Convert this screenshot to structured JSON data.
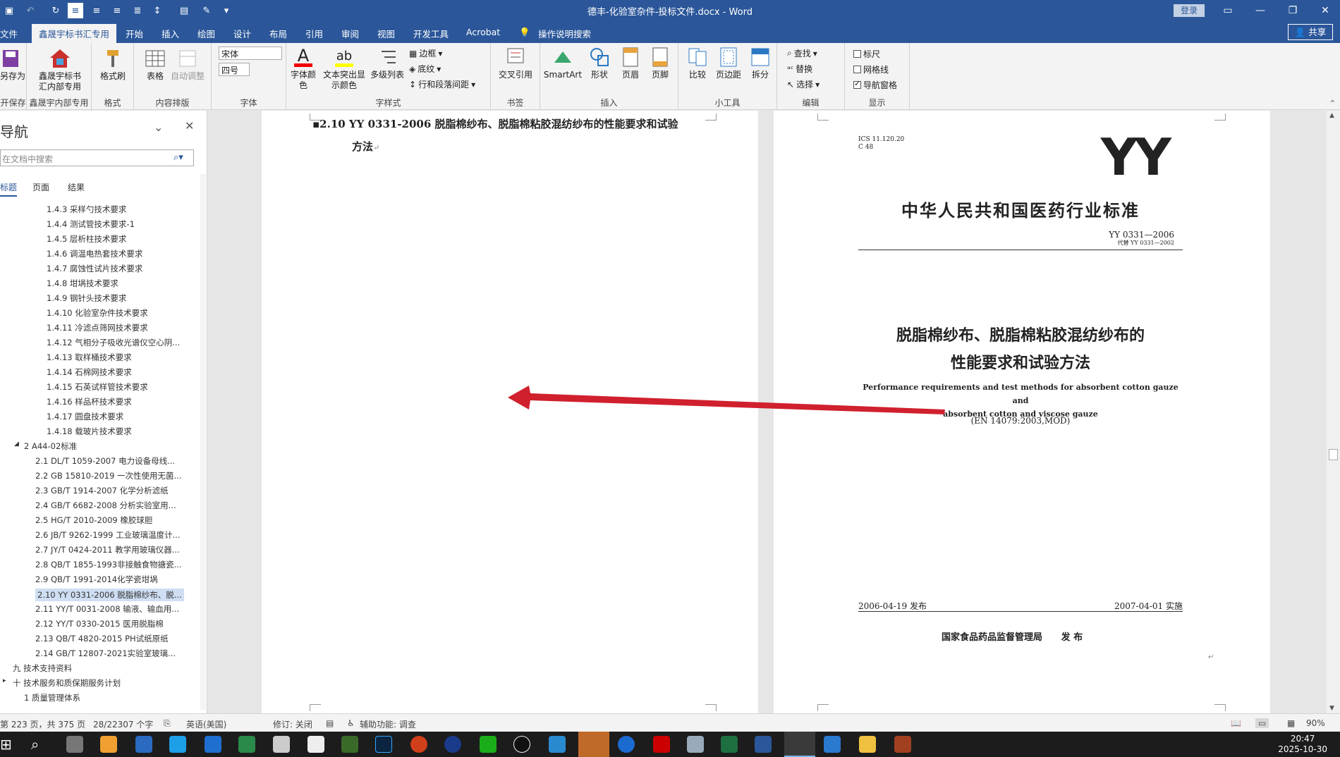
{
  "titlebar": {
    "title": "德丰-化验室杂件-投标文件.docx  -  Word",
    "login": "登录"
  },
  "tabs": [
    "文件",
    "鑫晟宇标书汇专用",
    "开始",
    "插入",
    "绘图",
    "设计",
    "布局",
    "引用",
    "审阅",
    "视图",
    "开发工具",
    "Acrobat",
    "操作说明搜索"
  ],
  "share": "共享",
  "ribbon": {
    "save_as": "另存为",
    "group_save": "开保存",
    "xsy_button": "鑫晟宇标书汇内部专用",
    "group_xsy": "鑫晟宇内部专用",
    "format_painter": "格式刷",
    "group_format": "格式",
    "table": "表格",
    "auto_adjust": "自动调整",
    "group_content": "内容排版",
    "font_name": "宋体",
    "font_size": "四号",
    "group_font": "字体",
    "font_color": "字体颜色",
    "highlight": "文本突出显示颜色",
    "multilevel": "多级列表",
    "border": "边框",
    "shading": "底纹",
    "line_spacing": "行和段落间距",
    "group_style": "字样式",
    "cross_ref": "交叉引用",
    "group_bookmark": "书签",
    "smartart": "SmartArt",
    "shapes": "形状",
    "header": "页眉",
    "footer": "页脚",
    "group_insert": "插入",
    "compare": "比较",
    "margins": "页边距",
    "split": "拆分",
    "group_tools": "小工具",
    "find": "查找",
    "replace": "替换",
    "select": "选择",
    "group_edit": "编辑",
    "ruler": "标尺",
    "gridlines": "网格线",
    "nav_pane": "导航窗格",
    "group_show": "显示"
  },
  "nav": {
    "title": "导航",
    "search_placeholder": "在文档中搜索",
    "tabs": [
      "标题",
      "页面",
      "结果"
    ],
    "items": [
      "1.4.3 采样勺技术要求",
      "1.4.4 测试管技术要求-1",
      "1.4.5 层析柱技术要求",
      "1.4.6 调温电热套技术要求",
      "1.4.7 腐蚀性试片技术要求",
      "1.4.8 坩埚技术要求",
      "1.4.9 钢针头技术要求",
      "1.4.10 化验室杂件技术要求",
      "1.4.11 冷滤点筛网技术要求",
      "1.4.12 气相分子吸收光谱仪空心阴...",
      "1.4.13 取样桶技术要求",
      "1.4.14 石棉网技术要求",
      "1.4.15 石英试样管技术要求",
      "1.4.16 样品杯技术要求",
      "1.4.17 圆盘技术要求",
      "1.4.18 载玻片技术要求",
      "2 A44-02标准",
      "2.1 DL/T 1059-2007 电力设备母线...",
      "2.2 GB 15810-2019 一次性使用无菌...",
      "2.3 GB/T 1914-2007 化学分析滤纸",
      "2.4 GB/T 6682-2008 分析实验室用...",
      "2.5 HG/T 2010-2009 橡胶球胆",
      "2.6 JB/T 9262-1999 工业玻璃温度计...",
      "2.7 JY/T 0424-2011 教学用玻璃仪器...",
      "2.8 QB/T 1855-1993非接触食物搪瓷...",
      "2.9 QB/T 1991-2014化学瓷坩埚",
      "2.10 YY 0331-2006 脱脂棉纱布、脱...",
      "2.11 YY/T 0031-2008 输液、输血用...",
      "2.12 YY/T 0330-2015 医用脱脂棉",
      "2.13 QB/T 4820-2015 PH试纸原纸",
      "2.14 GB/T 12807-2021实验室玻璃...",
      "九 技术支持资料",
      "十 技术服务和质保期服务计划",
      "1 质量管理体系"
    ]
  },
  "doc": {
    "heading_line1": "2.10 YY 0331-2006 脱脂棉纱布、脱脂棉粘胶混纺纱布的性能要求和试验",
    "heading_line2": "方法",
    "std_ics": "ICS 11.120.20",
    "std_c": "C 48",
    "std_logo": "YY",
    "std_org": "中华人民共和国医药行业标准",
    "std_no": "YY 0331—2006",
    "std_replace": "代替 YY 0331—2002",
    "std_title1": "脱脂棉纱布、脱脂棉粘胶混纺纱布的",
    "std_title2": "性能要求和试验方法",
    "std_en1": "Performance requirements and test methods for absorbent cotton gauze and",
    "std_en2": "absorbent cotton and viscose gauze",
    "std_en_ref": "(EN 14079:2003,MOD)",
    "std_pub": "2006-04-19 发布",
    "std_impl": "2007-04-01 实施",
    "std_issuer": "国家食品药品监督管理局",
    "std_issue": "发 布"
  },
  "status": {
    "page": "第 223 页，共 375 页",
    "words": "28/22307 个字",
    "lang": "英语(美国)",
    "track": "修订: 关闭",
    "access": "辅助功能: 调查",
    "zoom": "90%"
  },
  "clock": {
    "time": "20:47",
    "date": "2025-10-30"
  },
  "colors": {
    "word_blue": "#2b579a",
    "arrow_red": "#d0202e",
    "selection": "#cfdef3"
  }
}
